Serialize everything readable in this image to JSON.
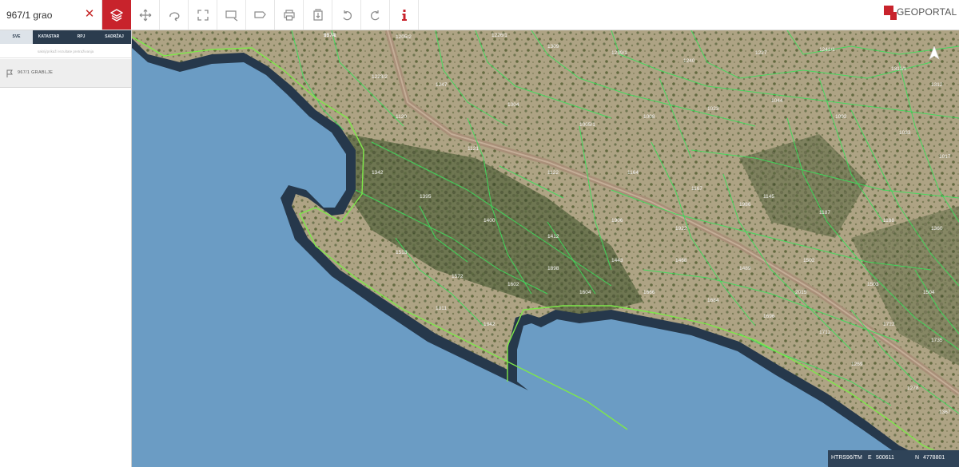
{
  "search": {
    "value": "967/1 grao",
    "placeholder": ""
  },
  "toolbar": {
    "tools": [
      {
        "name": "layers",
        "active": true
      },
      {
        "name": "pan"
      },
      {
        "name": "rotate"
      },
      {
        "name": "fullscreen"
      },
      {
        "name": "measure-area"
      },
      {
        "name": "measure-line"
      },
      {
        "name": "print"
      },
      {
        "name": "extract"
      },
      {
        "name": "undo"
      },
      {
        "name": "redo"
      },
      {
        "name": "info"
      }
    ]
  },
  "logo": {
    "text": "GEOPORTAL"
  },
  "sidebar": {
    "tabs": [
      {
        "label": "SVE",
        "active": true
      },
      {
        "label": "KATASTAR"
      },
      {
        "label": "RPJ"
      },
      {
        "label": "SADRŽAJ"
      }
    ],
    "filter_hint": "sakrij/prikaži rezultate pretraživanja",
    "results": [
      {
        "label": "967/1 GRABLJE"
      }
    ]
  },
  "map": {
    "parcel_labels": [
      "957/1",
      "1205/2",
      "1226/1",
      "1309",
      "1239/1",
      "1240",
      "1227",
      "1241/1",
      "1311/1",
      "1312",
      "1223/2",
      "1247",
      "1004",
      "1005/1",
      "1008",
      "1023",
      "1044",
      "1092",
      "1033",
      "1017",
      "1120",
      "1121",
      "1122",
      "1164",
      "1167",
      "1145",
      "1187",
      "1188",
      "1360",
      "1342",
      "1395",
      "1400",
      "1412",
      "1443",
      "1468",
      "1489",
      "1502",
      "1503",
      "1504",
      "1518",
      "1572",
      "1602",
      "1604",
      "1666",
      "1684",
      "1696",
      "1712",
      "1722",
      "1735",
      "1811",
      "1842",
      "1898",
      "1906",
      "1922",
      "1986",
      "2015",
      "1269",
      "1278",
      "1367",
      "1274"
    ],
    "coordinate_system": "HTRS96/TM",
    "easting_label": "E",
    "easting": "500611",
    "northing_label": "N",
    "northing": "4778801",
    "colors": {
      "sea": "#6b9cc4",
      "shore_shadow": "#26384b",
      "land_light": "#b6ab8c",
      "land_dark": "#5c6a43",
      "parcel_lines": "#39e05a",
      "road": "#a88f78",
      "accent": "#c8232c"
    }
  }
}
